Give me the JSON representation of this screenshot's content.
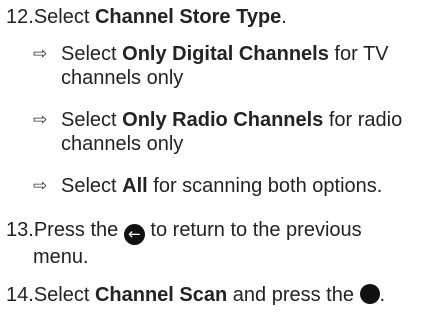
{
  "step12": {
    "num": "12.",
    "pre": "Select ",
    "bold": "Channel Store Type",
    "post": ".",
    "options": [
      {
        "pre": "Select ",
        "bold": "Only Digital Channels",
        "post1": " for TV",
        "post2": "channels only"
      },
      {
        "pre": "Select ",
        "bold": "Only Radio Channels",
        "post1": " for radio",
        "post2": "channels only"
      },
      {
        "pre": "Select ",
        "bold": "All",
        "post1": " for scanning both options.",
        "post2": ""
      }
    ]
  },
  "step13": {
    "num": "13.",
    "pre": "Press the ",
    "post1": " to return to the previous",
    "post2": "menu.",
    "icon": "back-arrow-icon"
  },
  "step14": {
    "num": "14.",
    "pre": "Select ",
    "bold": "Channel Scan",
    "mid": " and press the ",
    "post": ".",
    "icon": "ok-button-icon"
  }
}
